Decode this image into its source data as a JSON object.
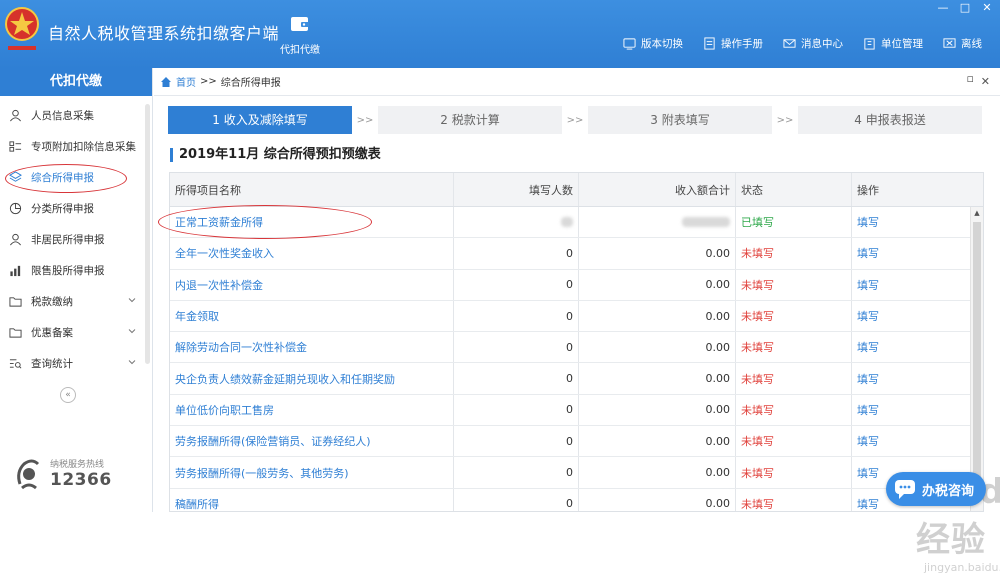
{
  "header": {
    "app_title": "自然人税收管理系统扣缴客户端",
    "module_label": "代扣代缴",
    "links": [
      {
        "label": "版本切换",
        "icon": "switch-icon"
      },
      {
        "label": "操作手册",
        "icon": "manual-icon"
      },
      {
        "label": "消息中心",
        "icon": "message-icon"
      },
      {
        "label": "单位管理",
        "icon": "company-icon"
      },
      {
        "label": "离线",
        "icon": "offline-icon"
      }
    ],
    "window_controls": [
      "—",
      "□",
      "✕"
    ]
  },
  "sidebar": {
    "title": "代扣代缴",
    "items": [
      {
        "label": "人员信息采集",
        "icon": "person-icon"
      },
      {
        "label": "专项附加扣除信息采集",
        "icon": "list-icon"
      },
      {
        "label": "综合所得申报",
        "icon": "layers-icon"
      },
      {
        "label": "分类所得申报",
        "icon": "pie-icon"
      },
      {
        "label": "非居民所得申报",
        "icon": "person-icon"
      },
      {
        "label": "限售股所得申报",
        "icon": "bar-chart-icon"
      },
      {
        "label": "税款缴纳",
        "icon": "folder-icon"
      },
      {
        "label": "优惠备案",
        "icon": "folder-icon"
      },
      {
        "label": "查询统计",
        "icon": "search-list-icon"
      }
    ],
    "collapse": "«",
    "hotline_label": "纳税服务热线",
    "hotline_number": "12366"
  },
  "breadcrumb": {
    "home": "首页",
    "sep": ">>",
    "current": "综合所得申报",
    "min": "▫",
    "close": "✕"
  },
  "steps": [
    {
      "label": "1 收入及减除填写"
    },
    {
      "label": "2 税款计算"
    },
    {
      "label": "3 附表填写"
    },
    {
      "label": "4 申报表报送"
    }
  ],
  "step_sep": ">>",
  "section_title": "2019年11月  综合所得预扣预缴表",
  "table": {
    "headers": [
      "所得项目名称",
      "填写人数",
      "收入额合计",
      "状态",
      "操作"
    ],
    "rows": [
      {
        "name": "正常工资薪金所得",
        "count": "",
        "income": "",
        "status": "已填写",
        "action": "填写"
      },
      {
        "name": "全年一次性奖金收入",
        "count": "0",
        "income": "0.00",
        "status": "未填写",
        "action": "填写"
      },
      {
        "name": "内退一次性补偿金",
        "count": "0",
        "income": "0.00",
        "status": "未填写",
        "action": "填写"
      },
      {
        "name": "年金领取",
        "count": "0",
        "income": "0.00",
        "status": "未填写",
        "action": "填写"
      },
      {
        "name": "解除劳动合同一次性补偿金",
        "count": "0",
        "income": "0.00",
        "status": "未填写",
        "action": "填写"
      },
      {
        "name": "央企负责人绩效薪金延期兑现收入和任期奖励",
        "count": "0",
        "income": "0.00",
        "status": "未填写",
        "action": "填写"
      },
      {
        "name": "单位低价向职工售房",
        "count": "0",
        "income": "0.00",
        "status": "未填写",
        "action": "填写"
      },
      {
        "name": "劳务报酬所得(保险营销员、证券经纪人)",
        "count": "0",
        "income": "0.00",
        "status": "未填写",
        "action": "填写"
      },
      {
        "name": "劳务报酬所得(一般劳务、其他劳务)",
        "count": "0",
        "income": "0.00",
        "status": "未填写",
        "action": "填写"
      },
      {
        "name": "稿酬所得",
        "count": "0",
        "income": "0.00",
        "status": "未填写",
        "action": "填写"
      }
    ]
  },
  "consult_button": "办税咨询",
  "watermark": {
    "main": "Baidu经验",
    "sub": "jingyan.baidu.com"
  },
  "colors": {
    "brand": "#2f7fd4",
    "done": "#2ea84a",
    "todo": "#e0413b",
    "annotation": "#d8363a"
  }
}
